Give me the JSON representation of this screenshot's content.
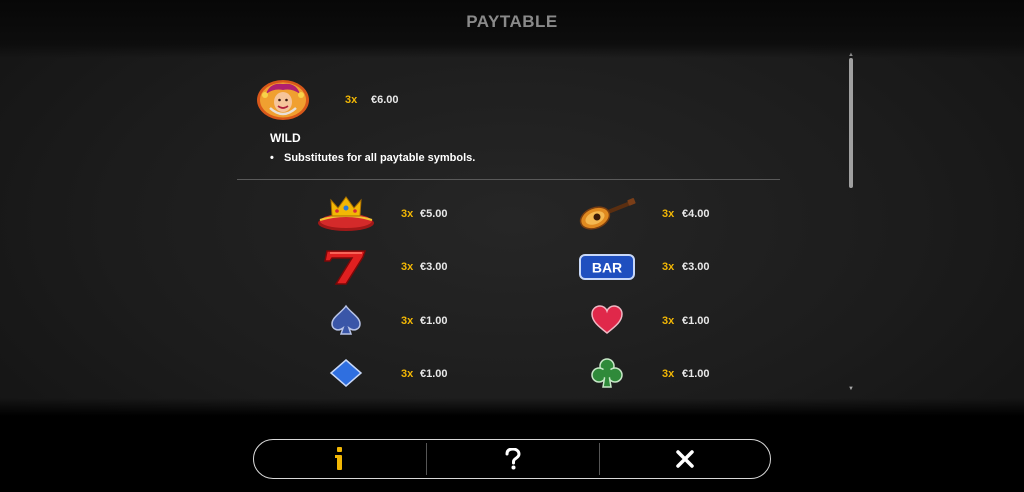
{
  "header": {
    "title": "PAYTABLE"
  },
  "wild": {
    "icon": "jester-icon",
    "multiplier": "3x",
    "amount": "€6.00",
    "label": "WILD",
    "description": "Substitutes for all paytable symbols."
  },
  "symbols": [
    {
      "icon": "crown-icon",
      "multiplier": "3x",
      "amount": "€5.00"
    },
    {
      "icon": "mandolin-icon",
      "multiplier": "3x",
      "amount": "€4.00"
    },
    {
      "icon": "seven-icon",
      "multiplier": "3x",
      "amount": "€3.00"
    },
    {
      "icon": "bar-icon",
      "icon_text": "BAR",
      "multiplier": "3x",
      "amount": "€3.00"
    },
    {
      "icon": "spade-icon",
      "multiplier": "3x",
      "amount": "€1.00"
    },
    {
      "icon": "heart-icon",
      "multiplier": "3x",
      "amount": "€1.00"
    },
    {
      "icon": "diamond-icon",
      "multiplier": "3x",
      "amount": "€1.00"
    },
    {
      "icon": "club-icon",
      "multiplier": "3x",
      "amount": "€1.00"
    }
  ],
  "nav": {
    "info_icon": "info-icon",
    "help_icon": "question-icon",
    "close_icon": "close-icon",
    "active_color": "#f2b705"
  },
  "colors": {
    "multiplier": "#f2b705",
    "amount": "#e8e8e8"
  }
}
